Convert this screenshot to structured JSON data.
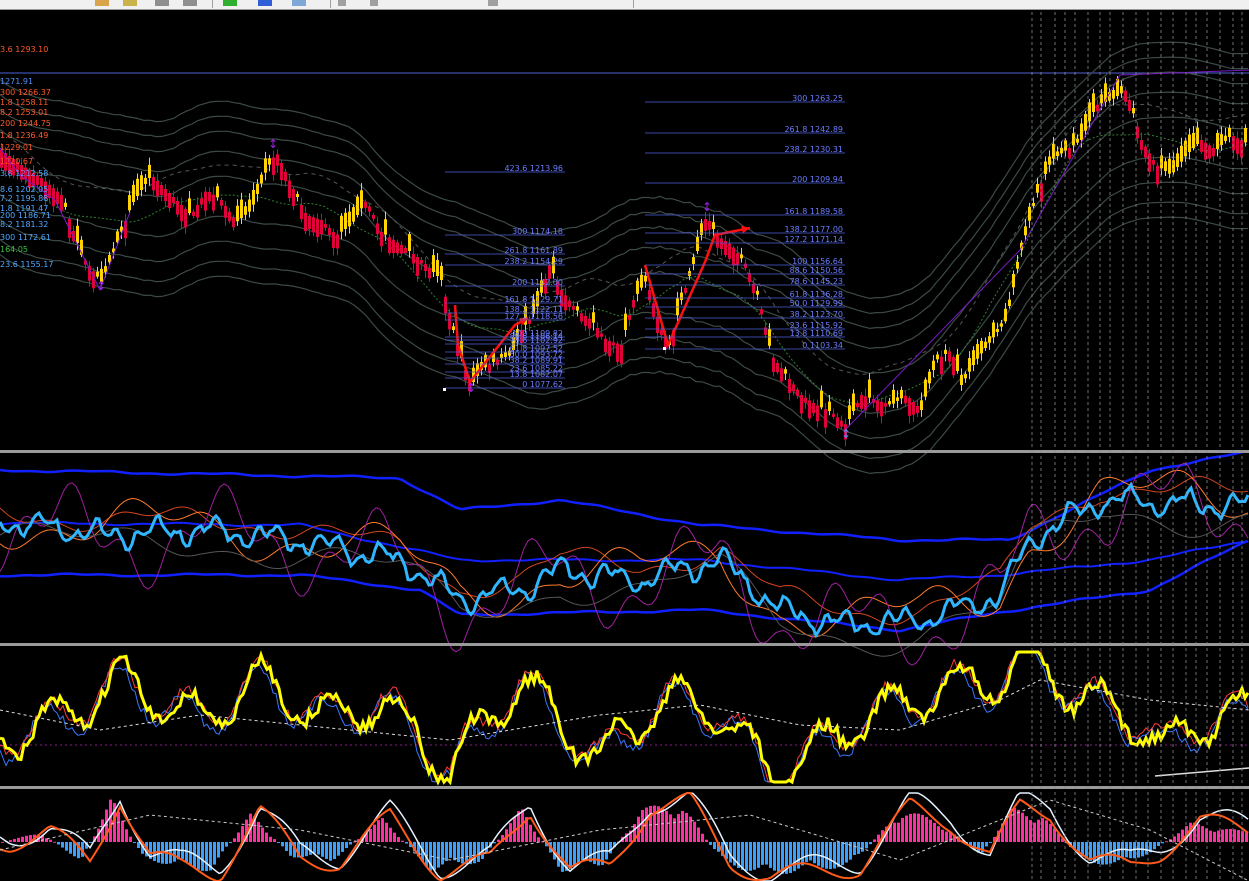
{
  "toolbar": {
    "icons": [
      "zoom-in-icon",
      "zoom-out-icon",
      "tile-icon",
      "scroll-icon",
      "chart-shift-icon",
      "add-indicator-icon",
      "period-icon",
      "template-icon",
      "crosshair-icon",
      "line-icon",
      "text-icon"
    ]
  },
  "colors": {
    "background": "#000000",
    "bull_candle": "#ffd400",
    "bear_candle": "#e0003a",
    "fib_lines": "#4f5fd8",
    "fib_text": "#6b7cff",
    "zigzag": "#ff1010",
    "envelope": "#3c4a44",
    "macd_pos": "#ff2fa0",
    "macd_neg": "#3aa0ff",
    "stoch_main": "#ffff00",
    "rsi_main": "#2fb6ff",
    "band_blue": "#1020ff"
  },
  "chart_data": [
    {
      "type": "candlestick",
      "panel": "main",
      "price_range": [
        1060,
        1310
      ],
      "left_labels": [
        {
          "text": "3.6 1293.10",
          "color": "#ff5a2a"
        },
        {
          "text": "1271.91",
          "color": "#4f8fff"
        },
        {
          "text": "300 1266.37",
          "color": "#ff5a2a"
        },
        {
          "text": "1.8 1258.11",
          "color": "#ff5a2a"
        },
        {
          "text": "8.2 1253.01",
          "color": "#ff5a2a"
        },
        {
          "text": "200 1244.75",
          "color": "#ff5a2a"
        },
        {
          "text": "1.8 1236.49",
          "color": "#ff5a2a"
        },
        {
          "text": "1229.01",
          "color": "#ff5a2a"
        },
        {
          "text": "1220.67",
          "color": "#ff5a2a"
        },
        {
          "text": "3.8 1212.58",
          "color": "#4fa8ff"
        },
        {
          "text": "8.6 1202.05",
          "color": "#4fa8ff"
        },
        {
          "text": "7.2 1195.88",
          "color": "#4fa8ff"
        },
        {
          "text": "1.8 1191.47",
          "color": "#4fa8ff"
        },
        {
          "text": "200 1186.71",
          "color": "#4fa8ff"
        },
        {
          "text": "8.2 1181.32",
          "color": "#4fa8ff"
        },
        {
          "text": "300 1172.61",
          "color": "#4fa8ff"
        },
        {
          "text": "164.05",
          "color": "#3fbf3f"
        },
        {
          "text": "23.6 1155.17",
          "color": "#4fa8ff"
        }
      ],
      "fib_set_1": [
        {
          "text": "423.6 1213.96"
        },
        {
          "text": "300 1174.18"
        },
        {
          "text": "261.8 1161.89"
        },
        {
          "text": "238.2 1154.29"
        },
        {
          "text": "200 1142.00"
        },
        {
          "text": "161.8 1129.71"
        },
        {
          "text": "138.2 1122.11"
        },
        {
          "text": "127.2 1118.56"
        },
        {
          "text": "100 1109.82"
        },
        {
          "text": "88.6 1106.14"
        },
        {
          "text": "78.6 1102.92"
        },
        {
          "text": "61.8 1097.52"
        },
        {
          "text": "50.0 1093.72"
        },
        {
          "text": "38.2 1089.91"
        },
        {
          "text": "23.6 1085.22"
        },
        {
          "text": "13.8 1082.07"
        },
        {
          "text": "0 1077.62"
        }
      ],
      "fib_set_2": [
        {
          "text": "300 1263.25"
        },
        {
          "text": "261.8 1242.89"
        },
        {
          "text": "238.2 1230.31"
        },
        {
          "text": "200 1209.94"
        },
        {
          "text": "161.8 1189.58"
        },
        {
          "text": "138.2 1177.00"
        },
        {
          "text": "127.2 1171.14"
        },
        {
          "text": "100 1156.64"
        },
        {
          "text": "88.6 1150.56"
        },
        {
          "text": "78.6 1145.23"
        },
        {
          "text": "61.8 1136.28"
        },
        {
          "text": "50.0 1129.99"
        },
        {
          "text": "38.2 1123.70"
        },
        {
          "text": "23.6 1115.92"
        },
        {
          "text": "13.8 1110.69"
        },
        {
          "text": "0 1103.34"
        }
      ]
    },
    {
      "type": "line",
      "panel": "bands"
    },
    {
      "type": "line",
      "panel": "stochastic"
    },
    {
      "type": "bar",
      "panel": "macd_histogram"
    }
  ]
}
